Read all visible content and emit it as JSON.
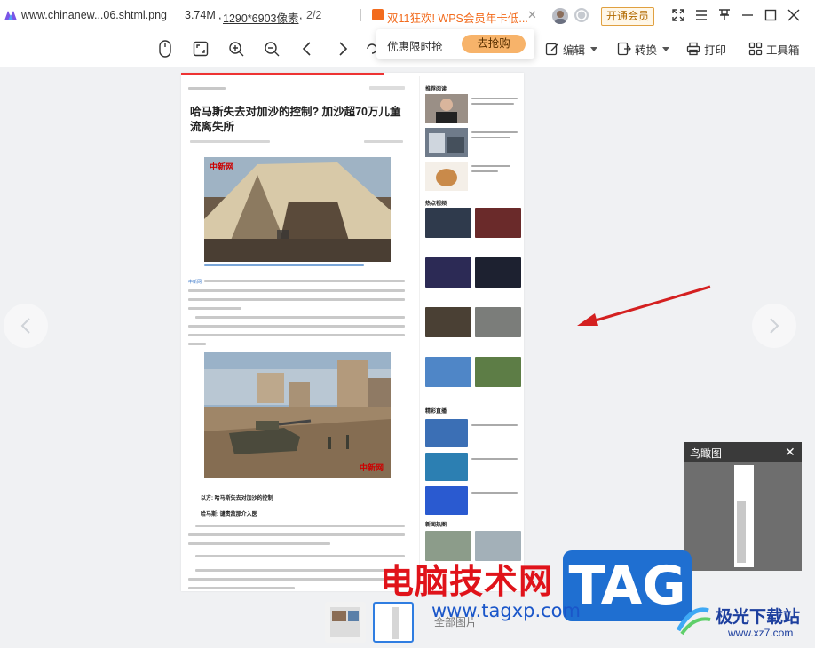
{
  "titlebar": {
    "file_name": "www.chinanew...06.shtml.png",
    "file_size": "3.74M",
    "resolution": "1290*6903像素",
    "page_indicator": "2/2",
    "promo_text": "双11狂欢! WPS会员年卡低...",
    "vip_button": "开通会员",
    "icons": [
      "fullscreen-icon",
      "menu-icon",
      "pin-icon",
      "minimize-icon",
      "maximize-icon",
      "close-icon"
    ]
  },
  "toolbar": {
    "icons": [
      "mouse-icon",
      "fit-screen-icon",
      "zoom-in-icon",
      "zoom-out-icon",
      "prev-icon",
      "next-icon",
      "rotate-icon"
    ],
    "edit_label": "编辑",
    "convert_label": "转换",
    "print_label": "打印",
    "toolbox_label": "工具箱"
  },
  "popup": {
    "text": "优惠限时抢",
    "button": "去抢购"
  },
  "article": {
    "title": "哈马斯失去对加沙的控制? 加沙超70万儿童流离失所",
    "intro_link": "中新网",
    "subhead1": "以方: 哈马斯失去对加沙的控制",
    "subhead2": "哈马斯: 谴责敌那介入医",
    "sidebar_heading1": "推荐阅读",
    "sidebar_heading2": "热点视频",
    "sidebar_heading3": "精彩直播",
    "sidebar_heading4": "新闻热图"
  },
  "birdview": {
    "title": "鸟瞰图"
  },
  "filmstrip": {
    "label": "全部图片"
  },
  "watermarks": {
    "cn_site": "电脑技术网",
    "url": "www.tagxp.com",
    "tag": "TAG",
    "jg_name": "极光下载站",
    "jg_url": "www.xz7.com"
  },
  "colors": {
    "accent_orange": "#f26b1d",
    "watermark_red": "#e0131a",
    "watermark_blue": "#1a56c9",
    "arrow_red": "#d42020"
  }
}
